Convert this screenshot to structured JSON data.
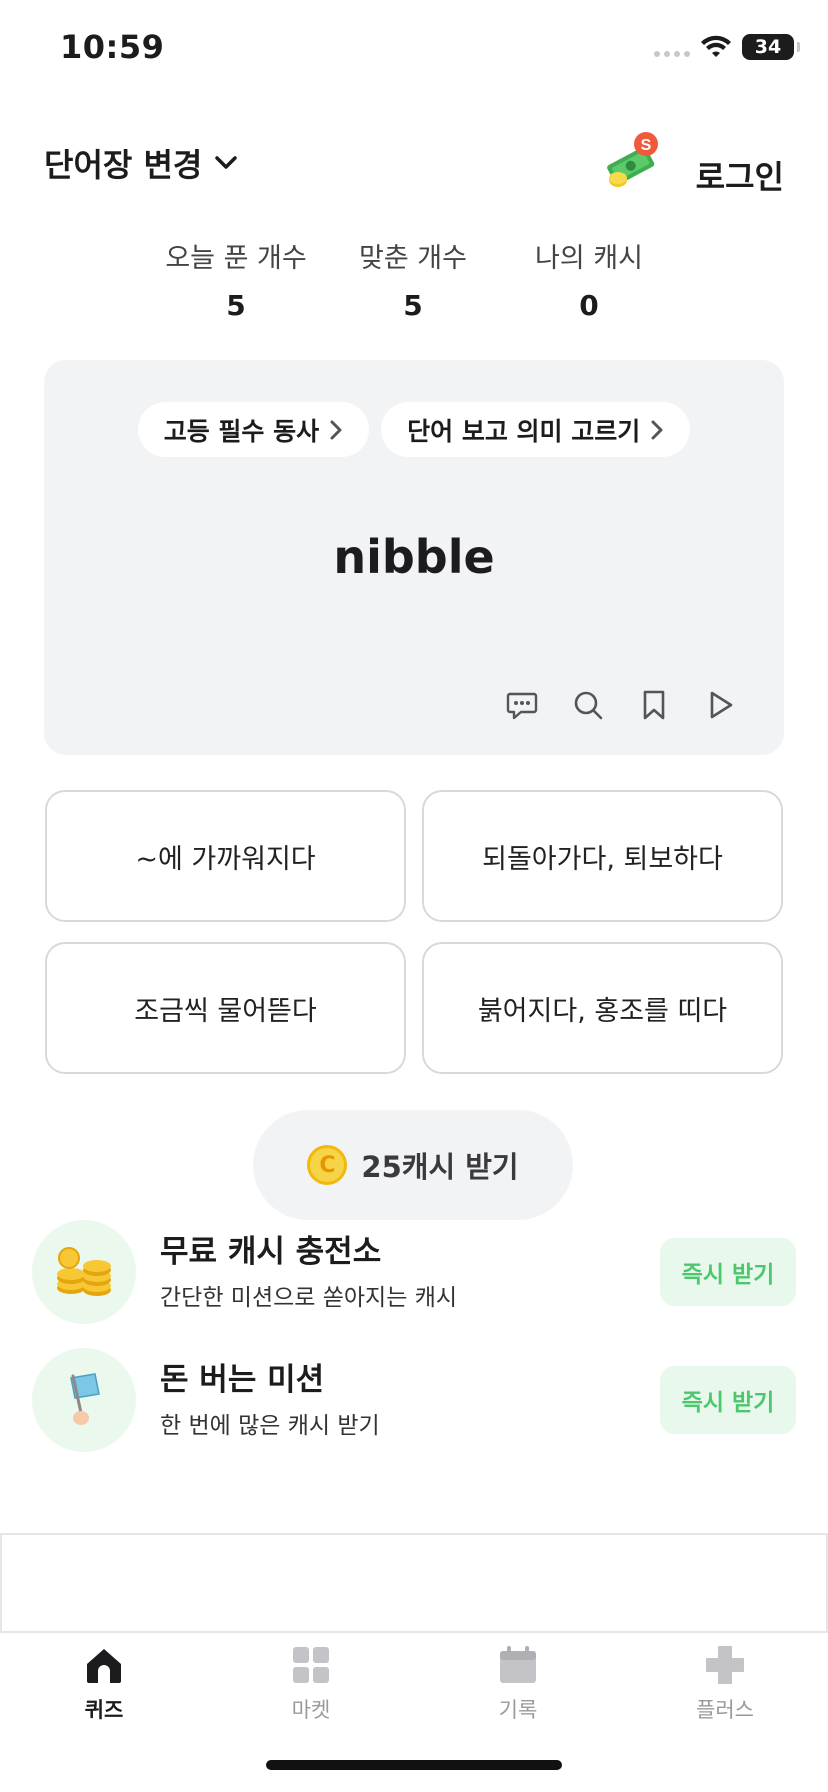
{
  "status_bar": {
    "time": "10:59",
    "battery": "34"
  },
  "header": {
    "wordbook_switch": "단어장 변경",
    "money_badge": "S",
    "login": "로그인"
  },
  "stats": [
    {
      "label": "오늘 푼 개수",
      "value": "5"
    },
    {
      "label": "맞춘 개수",
      "value": "5"
    },
    {
      "label": "나의 캐시",
      "value": "0"
    }
  ],
  "quiz": {
    "category_chip": "고등 필수 동사",
    "mode_chip": "단어 보고 의미 고르기",
    "word": "nibble",
    "actions": [
      "chat-icon",
      "search-icon",
      "bookmark-icon",
      "play-icon"
    ]
  },
  "options": [
    "~에 가까워지다",
    "되돌아가다, 퇴보하다",
    "조금씩 물어뜯다",
    "붉어지다, 홍조를 띠다"
  ],
  "cash_button": {
    "coin": "C",
    "label": "25캐시 받기"
  },
  "missions": [
    {
      "title": "무료 캐시 충전소",
      "subtitle": "간단한 미션으로 쏟아지는 캐시",
      "button": "즉시 받기",
      "icon": "coins-icon"
    },
    {
      "title": "돈 버는 미션",
      "subtitle": "한 번에 많은 캐시 받기",
      "button": "즉시 받기",
      "icon": "flag-icon"
    }
  ],
  "tabs": [
    {
      "label": "퀴즈",
      "icon": "home-icon",
      "active": true
    },
    {
      "label": "마켓",
      "icon": "grid-icon",
      "active": false
    },
    {
      "label": "기록",
      "icon": "calendar-icon",
      "active": false
    },
    {
      "label": "플러스",
      "icon": "plus-icon",
      "active": false
    }
  ],
  "colors": {
    "accent_green": "#4cc76b",
    "card_bg": "#f2f3f5",
    "active_tab": "#1c1c1e",
    "inactive_tab": "#9a9a9e"
  }
}
